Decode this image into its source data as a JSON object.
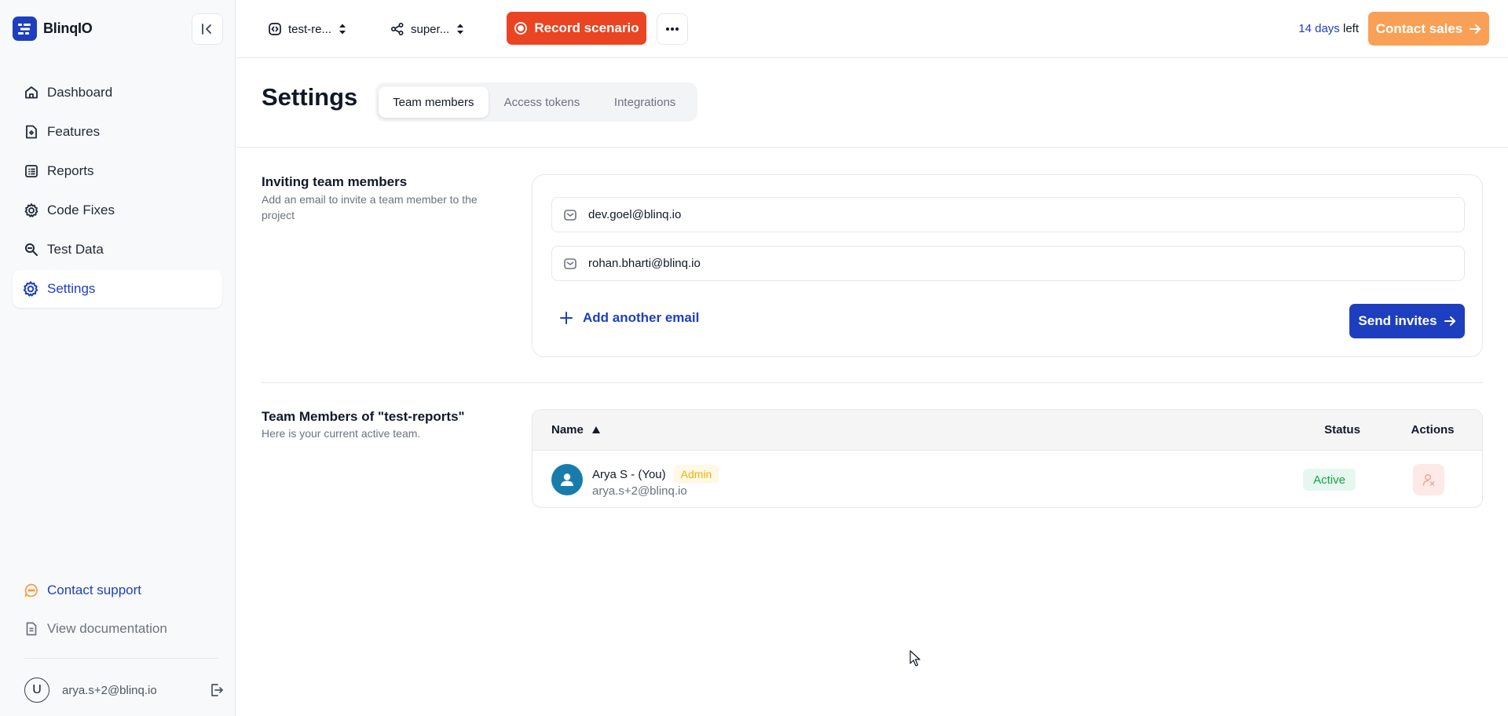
{
  "app": {
    "name": "BlinqIO"
  },
  "sidebar": {
    "items": [
      {
        "label": "Dashboard",
        "icon": "home-icon"
      },
      {
        "label": "Features",
        "icon": "feature-file-icon"
      },
      {
        "label": "Reports",
        "icon": "list-report-icon"
      },
      {
        "label": "Code Fixes",
        "icon": "gear-icon"
      },
      {
        "label": "Test Data",
        "icon": "search-data-icon"
      },
      {
        "label": "Settings",
        "icon": "settings-icon",
        "active": true
      }
    ],
    "support_label": "Contact support",
    "docs_label": "View documentation",
    "user_initial": "U",
    "user_email": "arya.s+2@blinq.io"
  },
  "topbar": {
    "project": "test-re...",
    "environment": "super...",
    "record_label": "Record scenario",
    "trial_days": "14 days",
    "trial_suffix": " left",
    "contact_sales_label": "Contact sales"
  },
  "page": {
    "title": "Settings",
    "tabs": [
      {
        "label": "Team members",
        "active": true
      },
      {
        "label": "Access tokens"
      },
      {
        "label": "Integrations"
      }
    ]
  },
  "invite": {
    "title": "Inviting team members",
    "description": "Add an email to invite a team member to the project",
    "emails": [
      "dev.goel@blinq.io",
      "rohan.bharti@blinq.io"
    ],
    "add_label": "Add another email",
    "send_label": "Send invites"
  },
  "team": {
    "title": "Team Members of \"test-reports\"",
    "description": "Here is your current active team.",
    "columns": {
      "name": "Name",
      "status": "Status",
      "actions": "Actions"
    },
    "members": [
      {
        "name": "Arya S - (You)",
        "role": "Admin",
        "email": "arya.s+2@blinq.io",
        "status": "Active"
      }
    ]
  },
  "colors": {
    "brand_blue": "#1d3fbf",
    "record_red": "#ea4423",
    "contact_orange": "#f9a056",
    "status_green": "#16a34a",
    "admin_yellow": "#eab308"
  }
}
